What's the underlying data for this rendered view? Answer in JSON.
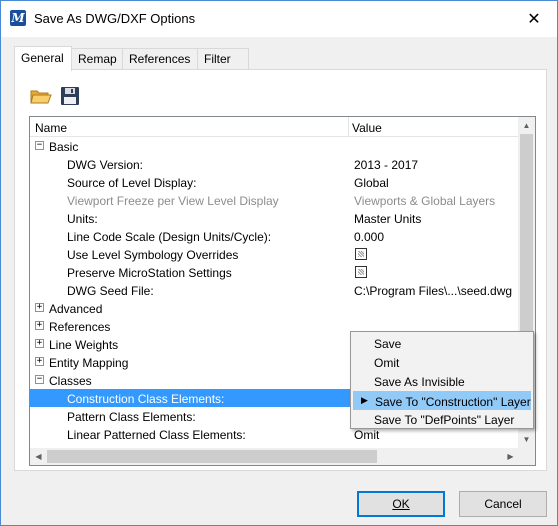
{
  "window": {
    "title": "Save As DWG/DXF Options",
    "app_icon": "microstation-logo-icon",
    "app_icon_letter": "M",
    "close_symbol": "✕"
  },
  "tabs": [
    {
      "label": "General",
      "active": true
    },
    {
      "label": "Remap",
      "active": false
    },
    {
      "label": "References",
      "active": false
    },
    {
      "label": "Filter",
      "active": false
    }
  ],
  "toolbar": {
    "open_icon": "open-folder-icon",
    "save_icon": "save-floppy-icon"
  },
  "grid": {
    "col_name": "Name",
    "col_value": "Value",
    "rows": [
      {
        "type": "group",
        "expander": "−",
        "label": "Basic"
      },
      {
        "type": "prop",
        "label": "DWG Version:",
        "value": "2013 - 2017"
      },
      {
        "type": "prop",
        "label": "Source of Level Display:",
        "value": "Global"
      },
      {
        "type": "prop",
        "label": "Viewport Freeze per View Level Display",
        "value": "Viewports & Global Layers",
        "disabled": true
      },
      {
        "type": "prop",
        "label": "Units:",
        "value": "Master Units"
      },
      {
        "type": "prop",
        "label": "Line Code Scale (Design Units/Cycle):",
        "value": "0.000"
      },
      {
        "type": "check",
        "label": "Use Level Symbology Overrides",
        "checked": "indeterminate"
      },
      {
        "type": "check",
        "label": "Preserve MicroStation Settings",
        "checked": "indeterminate"
      },
      {
        "type": "prop",
        "label": "DWG Seed File:",
        "value": "C:\\Program Files\\...\\seed.dwg"
      },
      {
        "type": "group",
        "expander": "+",
        "label": "Advanced"
      },
      {
        "type": "group",
        "expander": "+",
        "label": "References"
      },
      {
        "type": "group",
        "expander": "+",
        "label": "Line Weights"
      },
      {
        "type": "group",
        "expander": "+",
        "label": "Entity Mapping"
      },
      {
        "type": "group",
        "expander": "−",
        "label": "Classes"
      },
      {
        "type": "prop",
        "label": "Construction Class Elements:",
        "value": "",
        "selected": true
      },
      {
        "type": "prop",
        "label": "Pattern Class Elements:",
        "value": ""
      },
      {
        "type": "prop",
        "label": "Linear Patterned Class Elements:",
        "value": "Omit"
      }
    ]
  },
  "context_menu": {
    "items": [
      {
        "label": "Save",
        "highlight": false,
        "current": false
      },
      {
        "label": "Omit",
        "highlight": false,
        "current": false
      },
      {
        "label": "Save As Invisible",
        "highlight": false,
        "current": false
      },
      {
        "label": "Save To \"Construction\" Layer",
        "highlight": true,
        "current": true
      },
      {
        "label": "Save To \"DefPoints\" Layer",
        "highlight": false,
        "current": false
      }
    ],
    "current_marker": "▶"
  },
  "buttons": {
    "ok": "OK",
    "cancel": "Cancel"
  },
  "colors": {
    "selection": "#3399ff",
    "menu_highlight": "#91c9f7",
    "window_border": "#4a8ad4",
    "default_button_border": "#0078d7"
  }
}
